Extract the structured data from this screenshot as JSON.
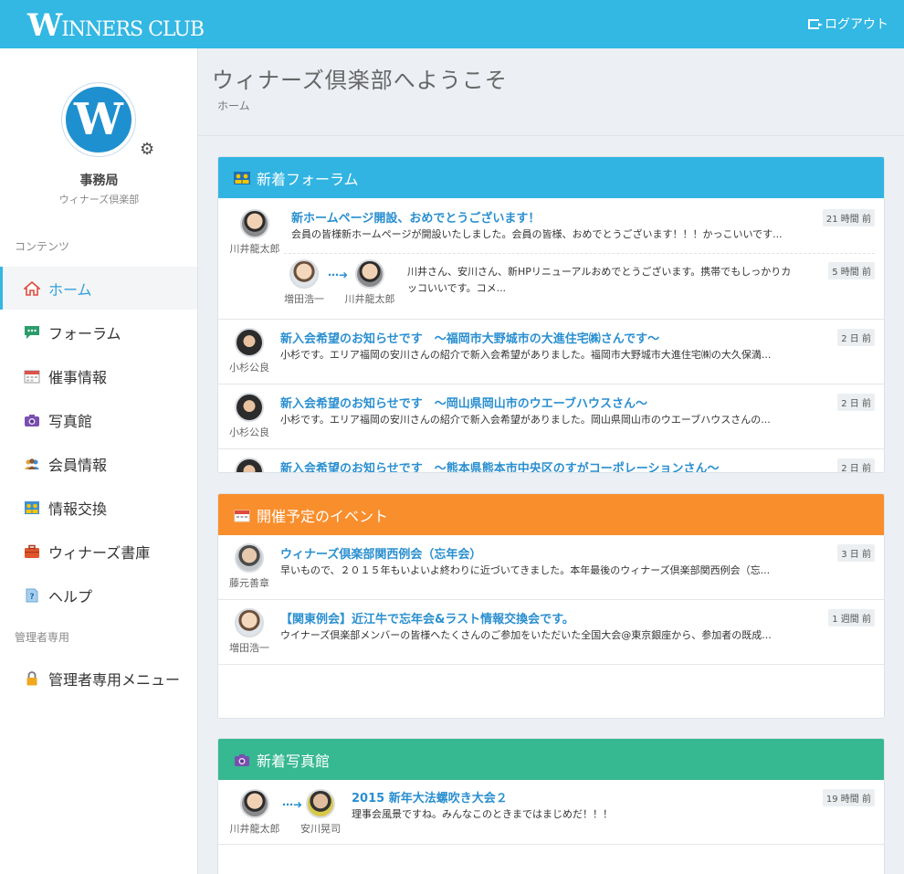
{
  "header": {
    "logo_big": "W",
    "logo_rest": "INNERS CLUB",
    "logout_label": "ログアウト"
  },
  "sidebar": {
    "profile": {
      "avatar_letter": "W",
      "name": "事務局",
      "org": "ウィナーズ倶楽部"
    },
    "section_contents": "コンテンツ",
    "items": [
      {
        "label": "ホーム",
        "icon": "home-icon",
        "color": "#e04a3b",
        "active": true
      },
      {
        "label": "フォーラム",
        "icon": "comment-icon",
        "color": "#2a9d6a"
      },
      {
        "label": "催事情報",
        "icon": "calendar-icon",
        "color": "#d9534f"
      },
      {
        "label": "写真館",
        "icon": "camera-icon",
        "color": "#7a4fb0"
      },
      {
        "label": "会員情報",
        "icon": "users-icon",
        "color": "#e0a23b"
      },
      {
        "label": "情報交換",
        "icon": "exchange-icon",
        "color": "#3a8ed8"
      },
      {
        "label": "ウィナーズ書庫",
        "icon": "briefcase-icon",
        "color": "#e0552a"
      },
      {
        "label": "ヘルプ",
        "icon": "help-icon",
        "color": "#6aa8d8"
      }
    ],
    "section_admin": "管理者専用",
    "admin_item": {
      "label": "管理者専用メニュー",
      "icon": "lock-icon",
      "color": "#e0a020"
    }
  },
  "main": {
    "title": "ウィナーズ倶楽部へようこそ",
    "breadcrumb": "ホーム"
  },
  "forum": {
    "heading": "新着フォーラム",
    "color": "#31b4e2",
    "posts": [
      {
        "author": "川井龍太郎",
        "title": "新ホームページ開設、おめでとうございます！",
        "excerpt": "会員の皆様新ホームページが開設いたしました。会員の皆様、おめでとうございます！！！かっこいいです...",
        "time": "21 時間 前"
      },
      {
        "from": "増田浩一",
        "to": "川井龍太郎",
        "excerpt_line1": "川井さん、安川さん、新HPリニューアルおめでとうございます。携帯でもしっかりカ",
        "excerpt_line2": "ッコいいです。コメ...",
        "time": "5 時間 前"
      },
      {
        "author": "小杉公良",
        "title": "新入会希望のお知らせです　～福岡市大野城市の大進住宅㈱さんです～",
        "excerpt": "小杉です。エリア福岡の安川さんの紹介で新入会希望がありました。福岡市大野城市大進住宅㈱の大久保満...",
        "time": "2 日 前"
      },
      {
        "author": "小杉公良",
        "title": "新入会希望のお知らせです　～岡山県岡山市のウエーブハウスさん～",
        "excerpt": "小杉です。エリア福岡の安川さんの紹介で新入会希望がありました。岡山県岡山市のウエーブハウスさんの...",
        "time": "2 日 前"
      },
      {
        "title": "新入会希望のお知らせです　～熊本県熊本市中央区のすがコーポレーションさん～",
        "time": "2 日 前"
      }
    ]
  },
  "events": {
    "heading": "開催予定のイベント",
    "color": "#f98e2c",
    "items": [
      {
        "author": "藤元善章",
        "title": "ウィナーズ倶楽部関西例会（忘年会）",
        "excerpt": "早いもので、２０１５年もいよいよ終わりに近づいてきました。本年最後のウィナーズ倶楽部関西例会（忘...",
        "time": "3 日 前"
      },
      {
        "author": "増田浩一",
        "title": "【関東例会】近江牛で忘年会&ラスト情報交換会です。",
        "excerpt": "ウイナーズ倶楽部メンバーの皆様へたくさんのご参加をいただいた全国大会@東京銀座から、参加者の既成...",
        "time": "1 週間 前"
      }
    ]
  },
  "photos": {
    "heading": "新着写真館",
    "color": "#36b890",
    "items": [
      {
        "from": "川井龍太郎",
        "to": "安川晃司",
        "title": "2015 新年大法螺吹き大会２",
        "excerpt": "理事会風景ですね。みんなこのときまではまじめだ！！！",
        "time": "19 時間 前"
      }
    ]
  }
}
